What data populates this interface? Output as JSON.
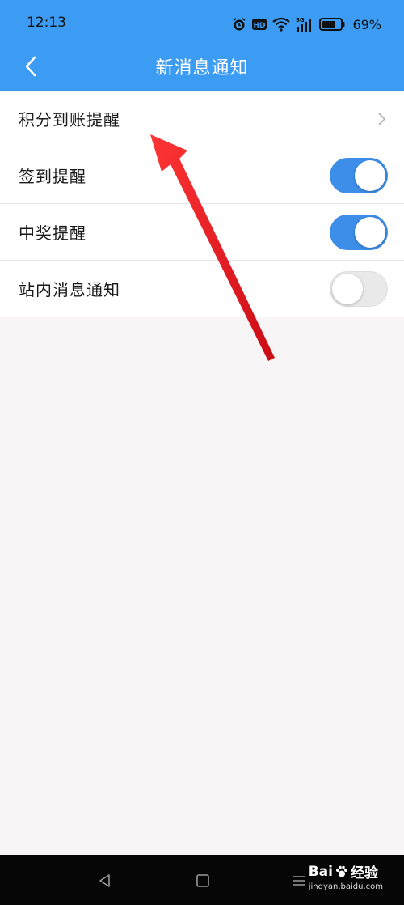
{
  "status_bar": {
    "time": "12:13",
    "network": "5G",
    "battery_percent": "69%"
  },
  "nav": {
    "title": "新消息通知"
  },
  "settings": [
    {
      "label": "积分到账提醒",
      "type": "link"
    },
    {
      "label": "签到提醒",
      "type": "toggle",
      "on": true
    },
    {
      "label": "中奖提醒",
      "type": "toggle",
      "on": true
    },
    {
      "label": "站内消息通知",
      "type": "toggle",
      "on": false
    }
  ],
  "watermark": {
    "brand_a": "Bai",
    "brand_b": "经验",
    "url": "jingyan.baidu.com"
  },
  "colors": {
    "header_blue": "#3c9cf4",
    "toggle_on": "#3c8ee8",
    "annotation_arrow": "#e8141c"
  }
}
